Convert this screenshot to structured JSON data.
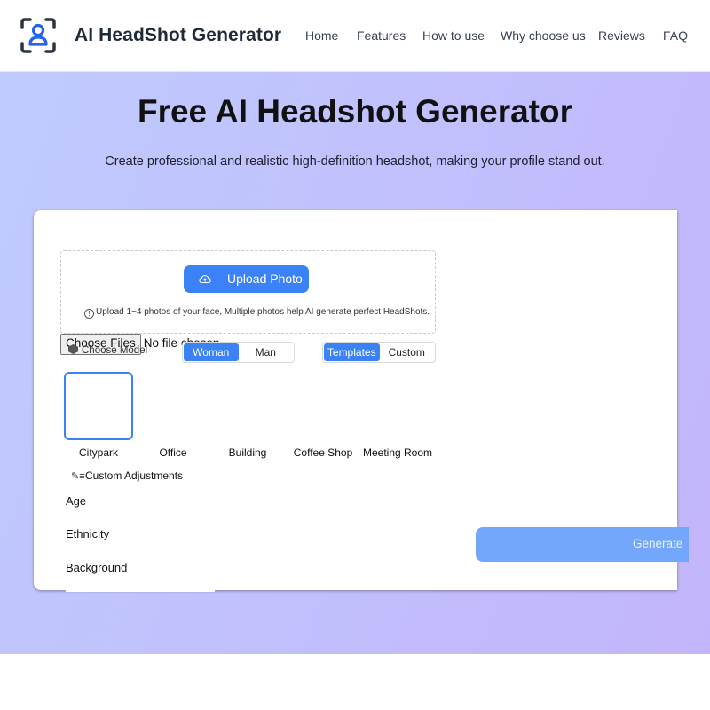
{
  "header": {
    "brand": "AI HeadShot Generator",
    "logo_icon": "user-scan-icon",
    "nav": [
      "Home",
      "Features",
      "How to use",
      "Why choose us",
      "Reviews",
      "FAQ"
    ]
  },
  "hero": {
    "title": "Free AI Headshot Generator",
    "subtitle": "Create professional and realistic high-definition headshot, making your profile stand out."
  },
  "upload": {
    "button_label": "Upload Photo",
    "hint": "Upload 1~4 photos of your face, Multiple photos help AI generate perfect HeadShots.",
    "file_button": "Choose Files",
    "file_status": "No file chosen"
  },
  "model": {
    "label": "Choose Model",
    "gender_options": [
      "Woman",
      "Man"
    ],
    "gender_selected": "Woman",
    "mode_options": [
      "Templates",
      "Custom"
    ],
    "mode_selected": "Templates"
  },
  "templates": [
    "Citypark",
    "Office",
    "Building",
    "Coffee Shop",
    "Meeting Room"
  ],
  "selected_template": "Citypark",
  "custom_adjustments": {
    "label": "Custom Adjustments",
    "fields": [
      "Age",
      "Ethnicity",
      "Background"
    ]
  },
  "generate": {
    "label": "Generate"
  },
  "colors": {
    "accent": "#3b82f6",
    "generate_disabled": "#72a7fb",
    "hero_gradient_start": "#c0cbfd",
    "hero_gradient_end": "#c3b5fb"
  }
}
